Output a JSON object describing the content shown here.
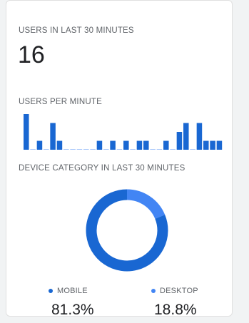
{
  "card": {
    "users_label": "USERS IN LAST 30 MINUTES",
    "users_count": "16",
    "per_minute_label": "USERS PER MINUTE",
    "device_label": "DEVICE CATEGORY IN LAST 30 MINUTES"
  },
  "legend": {
    "mobile": {
      "label": "MOBILE",
      "value": "81.3%",
      "color": "#1967d2"
    },
    "desktop": {
      "label": "DESKTOP",
      "value": "18.8%",
      "color": "#4285f4"
    }
  },
  "colors": {
    "bar": "#1967d2",
    "baseline": "#a8c7fa",
    "donut_track": "#1967d2"
  },
  "chart_data": [
    {
      "type": "bar",
      "title": "USERS PER MINUTE",
      "values": [
        4,
        0,
        1,
        0,
        3,
        1,
        0,
        0,
        0,
        0,
        0,
        1,
        0,
        1,
        0,
        1,
        0,
        1,
        1,
        0,
        0,
        1,
        0,
        2,
        3,
        0,
        3,
        1,
        1,
        1
      ],
      "ylim": [
        0,
        4
      ]
    },
    {
      "type": "pie",
      "title": "DEVICE CATEGORY IN LAST 30 MINUTES",
      "categories": [
        "MOBILE",
        "DESKTOP"
      ],
      "values": [
        81.3,
        18.8
      ]
    }
  ]
}
